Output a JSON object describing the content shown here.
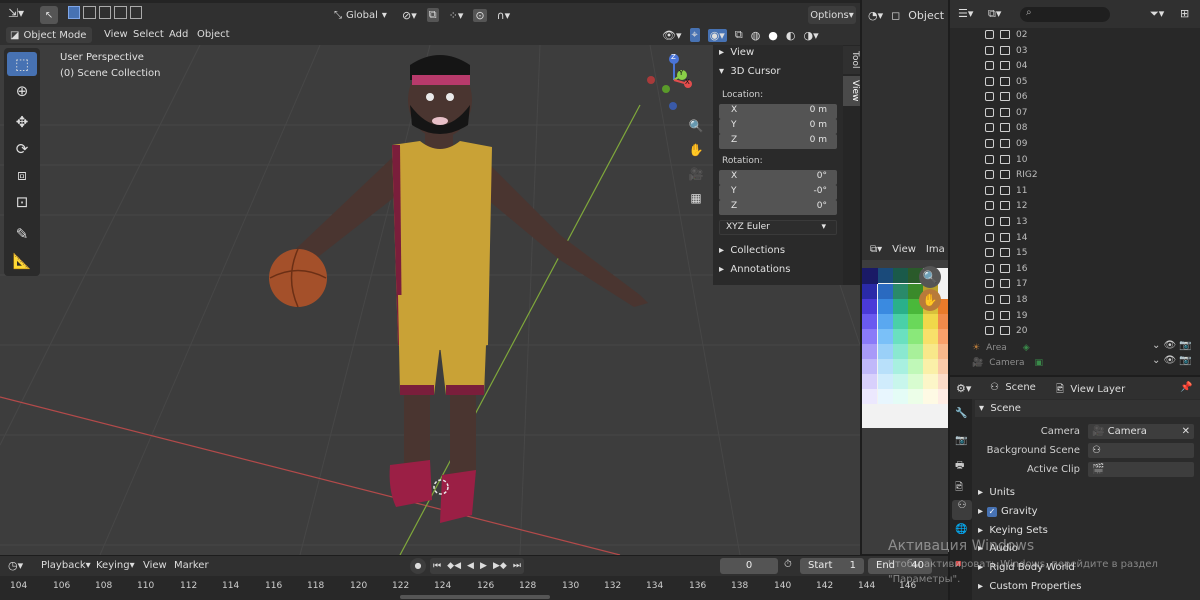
{
  "header": {
    "mode": "Object Mode",
    "menus": [
      "View",
      "Select",
      "Add",
      "Object"
    ],
    "transform_orientation": "Global",
    "options": "Options"
  },
  "viewport": {
    "perspective": "User Perspective",
    "collection": "(0) Scene Collection",
    "gizmo_axes": [
      "X",
      "Y",
      "Z"
    ]
  },
  "toolbar_tools": [
    "select-box",
    "cursor",
    "move",
    "rotate",
    "scale",
    "transform",
    "annotate",
    "measure"
  ],
  "nav_gizmos": [
    "zoom",
    "pan",
    "camera",
    "ortho-grid"
  ],
  "n_panel": {
    "tabs": [
      "Tool",
      "View"
    ],
    "view_section": "View",
    "cursor_section": "3D Cursor",
    "location_label": "Location:",
    "location": [
      {
        "axis": "X",
        "value": "0 m"
      },
      {
        "axis": "Y",
        "value": "0 m"
      },
      {
        "axis": "Z",
        "value": "0 m"
      }
    ],
    "rotation_label": "Rotation:",
    "rotation": [
      {
        "axis": "X",
        "value": "0°"
      },
      {
        "axis": "Y",
        "value": "-0°"
      },
      {
        "axis": "Z",
        "value": "0°"
      }
    ],
    "rotation_mode": "XYZ Euler",
    "collections": "Collections",
    "annotations": "Annotations"
  },
  "right_header": {
    "object_label": "Object"
  },
  "image_editor": {
    "view": "View",
    "image": "Ima"
  },
  "outliner": {
    "rows": [
      "02",
      "03",
      "04",
      "05",
      "06",
      "07",
      "08",
      "09",
      "10",
      "RIG2",
      "11",
      "12",
      "13",
      "14",
      "15",
      "16",
      "17",
      "18",
      "19",
      "20"
    ],
    "objects": [
      "Area",
      "Camera"
    ]
  },
  "properties": {
    "header_scene": "Scene",
    "header_view_layer": "View Layer",
    "section": "Scene",
    "camera_label": "Camera",
    "camera_value": "Camera",
    "background_label": "Background Scene",
    "clip_label": "Active Clip",
    "subsections": [
      "Units",
      "Gravity",
      "Keying Sets",
      "Audio",
      "Rigid Body World",
      "Custom Properties"
    ]
  },
  "timeline": {
    "menus": [
      "Playback",
      "Keying",
      "View",
      "Marker"
    ],
    "current_frame": "0",
    "start_label": "Start",
    "start": "1",
    "end_label": "End",
    "end": "40",
    "ruler": [
      "104",
      "106",
      "108",
      "110",
      "112",
      "114",
      "116",
      "118",
      "120",
      "122",
      "124",
      "126",
      "128",
      "130",
      "132",
      "134",
      "136",
      "138",
      "140",
      "142",
      "144",
      "146"
    ]
  },
  "watermark": {
    "line1": "Активация Windows",
    "line2": "Чтобы активировать Windows, перейдите в раздел",
    "line3": "\"Параметры\"."
  },
  "colors": {
    "accent": "#4772b3",
    "jersey": "#c9a236",
    "trim": "#7a1e3b",
    "skin": "#4a3530"
  }
}
